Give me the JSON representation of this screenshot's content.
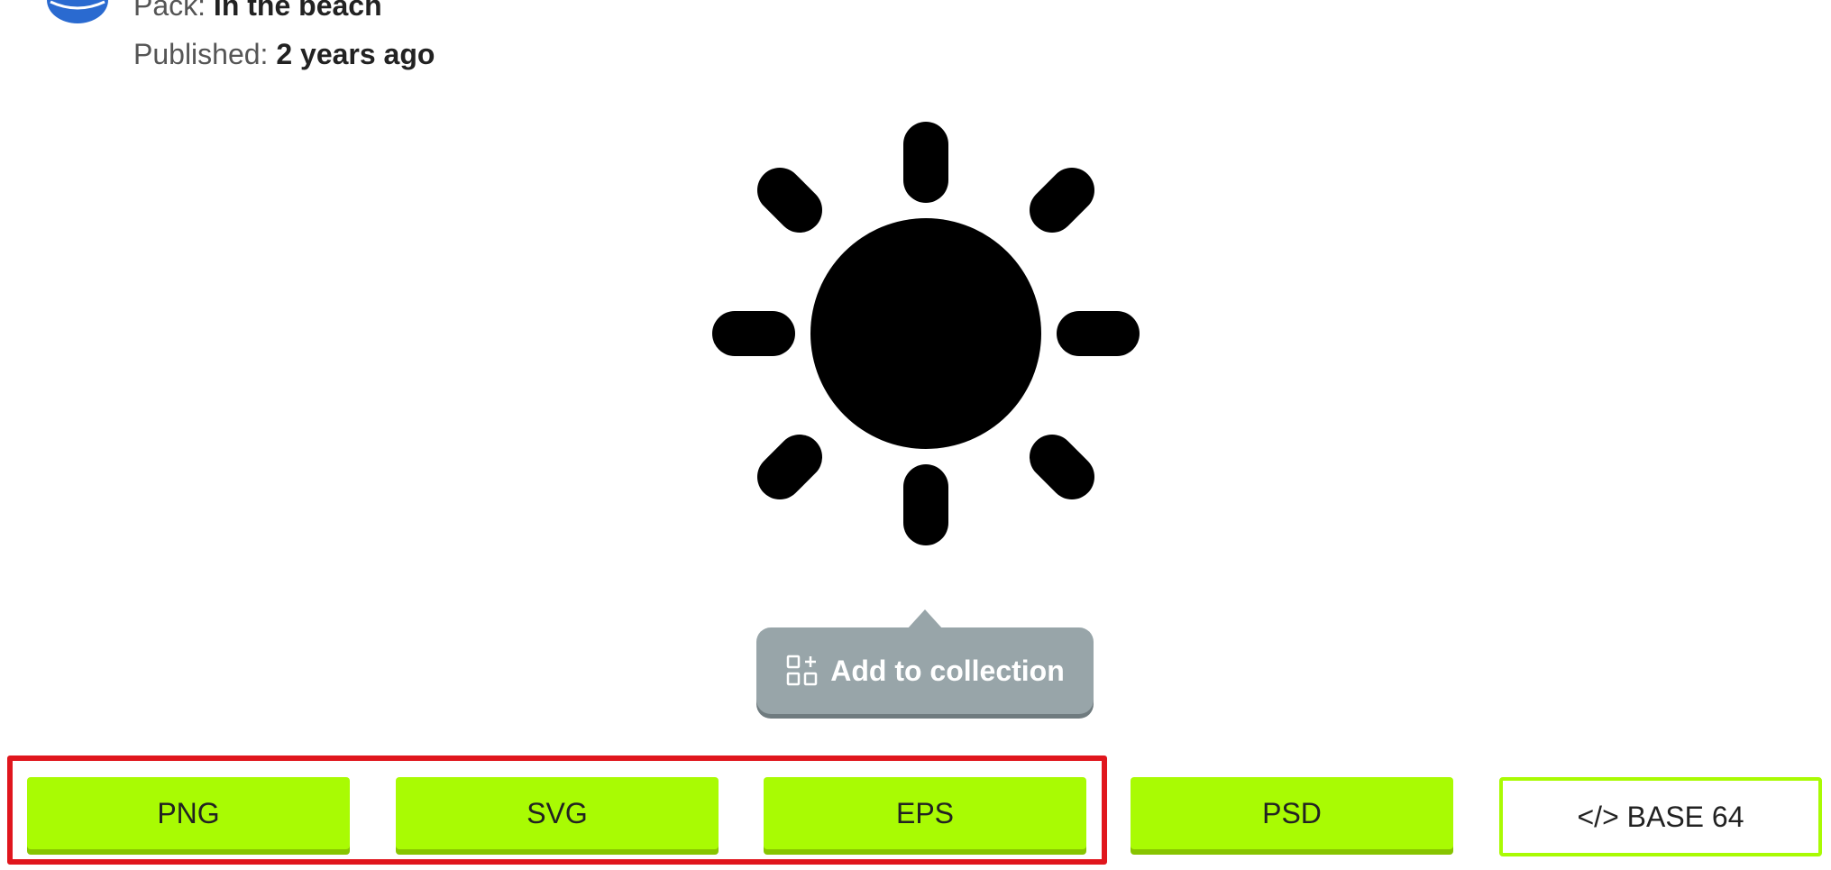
{
  "meta": {
    "pack_label": "Pack:",
    "pack_value": "In the beach",
    "published_label": "Published:",
    "published_value": "2 years ago"
  },
  "icon": {
    "name": "sun-icon",
    "color": "#000000"
  },
  "collection": {
    "label": "Add to collection",
    "icon": "add-collection-icon",
    "bg_color": "#98a5a9"
  },
  "downloads": {
    "formats": [
      "PNG",
      "SVG",
      "EPS",
      "PSD"
    ],
    "base64_label": "</> BASE 64",
    "accent_color": "#a9fb03",
    "highlight_color": "#e0161d"
  }
}
